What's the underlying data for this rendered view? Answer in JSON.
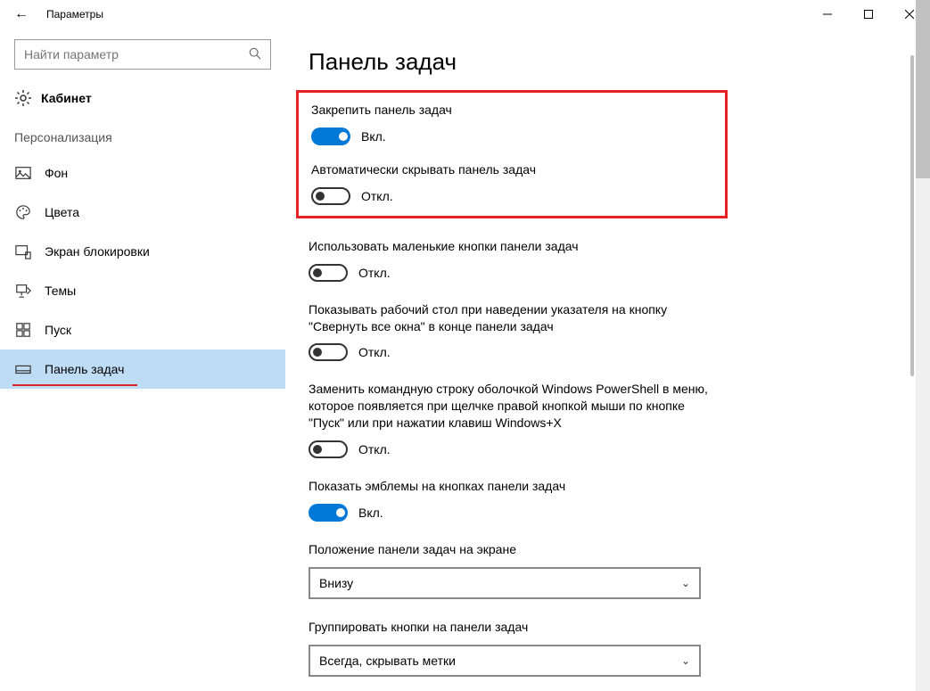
{
  "window": {
    "title": "Параметры"
  },
  "sidebar": {
    "search_placeholder": "Найти параметр",
    "home_label": "Кабинет",
    "category_label": "Персонализация",
    "items": [
      {
        "label": "Фон"
      },
      {
        "label": "Цвета"
      },
      {
        "label": "Экран блокировки"
      },
      {
        "label": "Темы"
      },
      {
        "label": "Пуск"
      },
      {
        "label": "Панель задач"
      }
    ]
  },
  "page": {
    "title": "Панель задач"
  },
  "toggle_states": {
    "on": "Вкл.",
    "off": "Откл."
  },
  "settings": {
    "lock": {
      "label": "Закрепить панель задач",
      "state": "on"
    },
    "autohide": {
      "label": "Автоматически скрывать панель задач",
      "state": "off"
    },
    "small_buttons": {
      "label": "Использовать маленькие кнопки панели задач",
      "state": "off"
    },
    "peek": {
      "label": "Показывать рабочий стол при наведении указателя на кнопку \"Свернуть все окна\" в конце панели задач",
      "state": "off"
    },
    "powershell": {
      "label": "Заменить командную строку оболочкой Windows PowerShell в меню, которое появляется при щелчке правой кнопкой мыши по кнопке \"Пуск\" или при нажатии клавиш Windows+X",
      "state": "off"
    },
    "badges": {
      "label": "Показать эмблемы на кнопках панели задач",
      "state": "on"
    },
    "position": {
      "label": "Положение панели задач на экране",
      "value": "Внизу"
    },
    "combine": {
      "label": "Группировать кнопки на панели задач",
      "value": "Всегда, скрывать метки"
    }
  }
}
